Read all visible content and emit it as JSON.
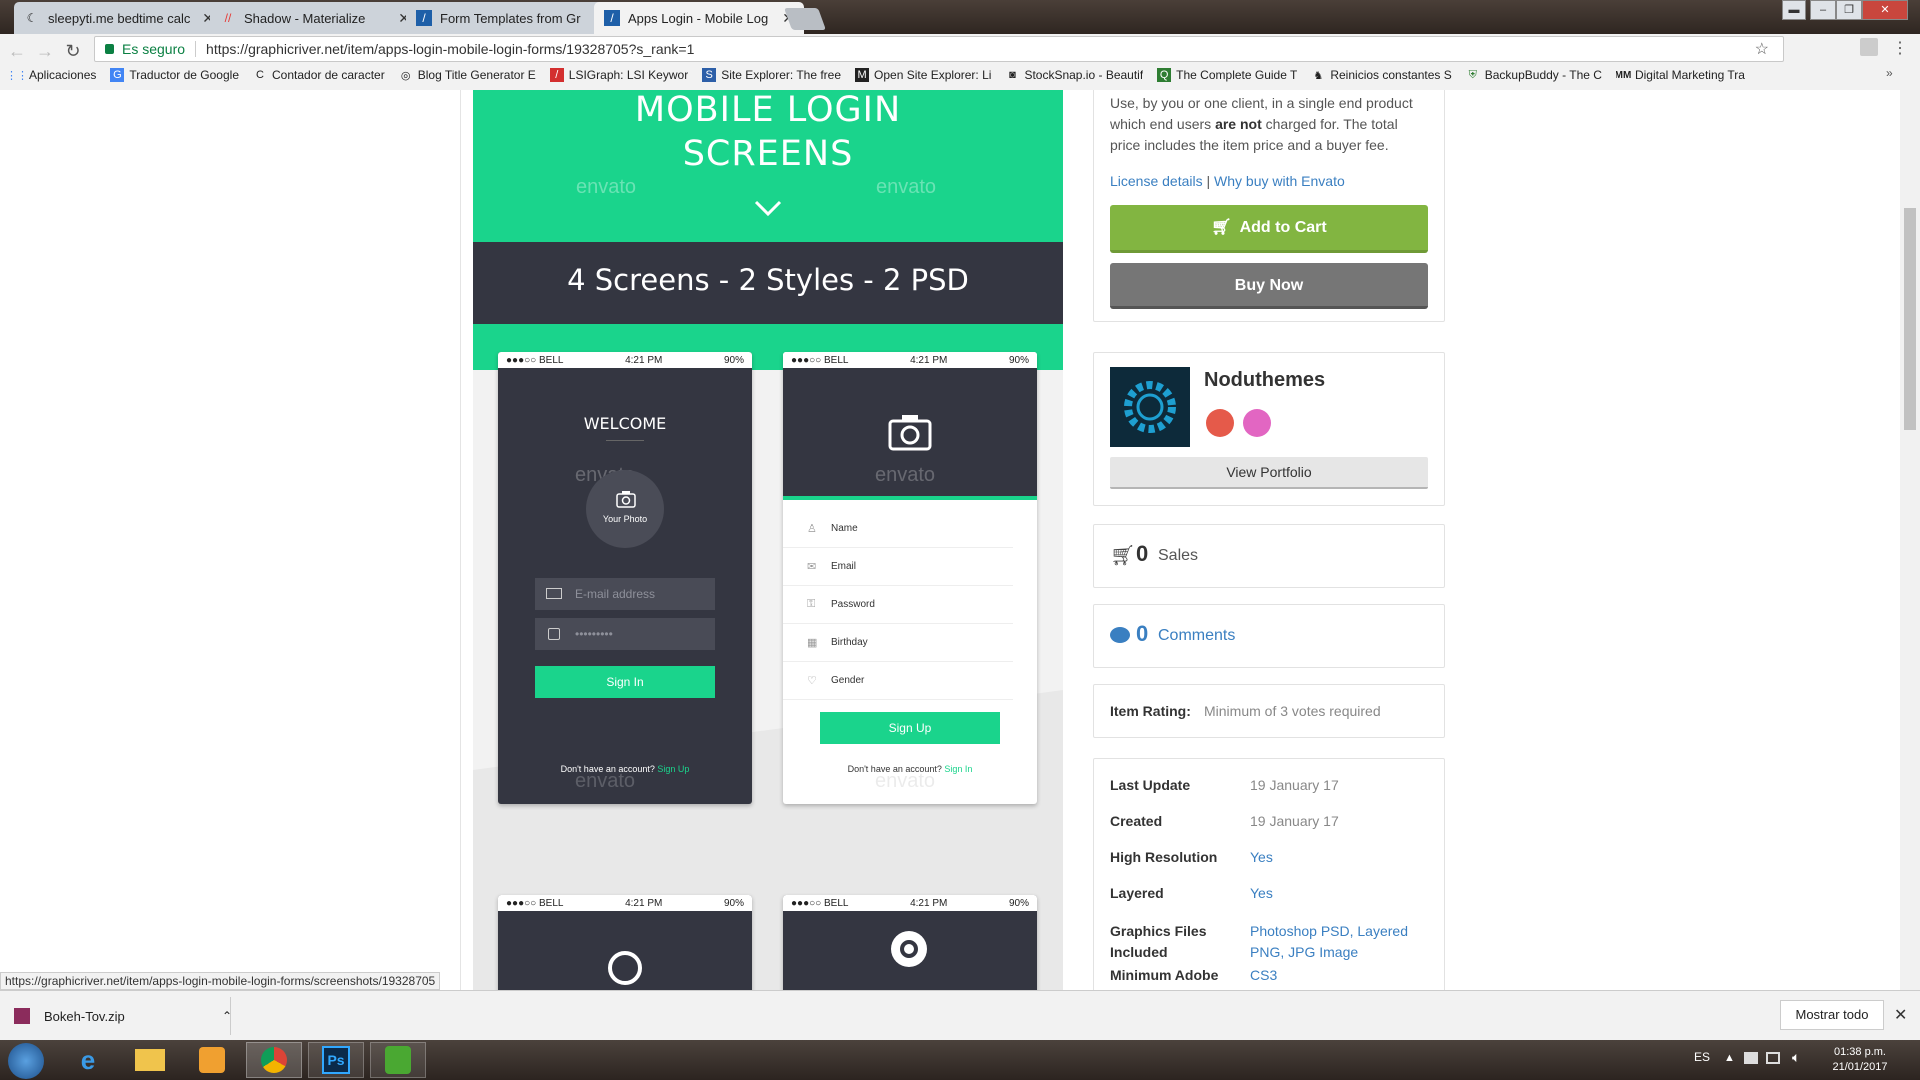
{
  "tabs": [
    {
      "label": "sleepyti.me bedtime calc",
      "icon": "moon-icon"
    },
    {
      "label": "Shadow - Materialize",
      "icon": "materialize-icon"
    },
    {
      "label": "Form Templates from Gr",
      "icon": "envato-icon"
    },
    {
      "label": "Apps Login - Mobile Log",
      "icon": "envato-icon"
    }
  ],
  "address_bar": {
    "secure_label": "Es seguro",
    "url": "https://graphicriver.net/item/apps-login-mobile-login-forms/19328705?s_rank=1"
  },
  "bookmarks": [
    {
      "label": "Aplicaciones"
    },
    {
      "label": "Traductor de Google"
    },
    {
      "label": "Contador de caracter"
    },
    {
      "label": "Blog Title Generator E"
    },
    {
      "label": "LSIGraph: LSI Keywor"
    },
    {
      "label": "Site Explorer: The free"
    },
    {
      "label": "Open Site Explorer: Li"
    },
    {
      "label": "StockSnap.io - Beautif"
    },
    {
      "label": "The Complete Guide T"
    },
    {
      "label": "Reinicios constantes S"
    },
    {
      "label": "BackupBuddy - The C"
    },
    {
      "label": "Digital Marketing Tra"
    }
  ],
  "preview": {
    "hero_line1": "MOBILE LOGIN",
    "hero_line2": "SCREENS",
    "watermark": "envato",
    "subtitle": "4 Screens - 2 Styles - 2 PSD",
    "status_carrier": "●●●○○ BELL",
    "status_time": "4:21 PM",
    "status_battery": "90%",
    "phone1": {
      "title": "WELCOME",
      "photo_label": "Your Photo",
      "email_placeholder": "E-mail address",
      "password_value": "•••••••••",
      "button": "Sign In",
      "footer": "Don't have an account?",
      "footer_link": "Sign Up"
    },
    "phone2": {
      "fields": [
        "Name",
        "Email",
        "Password",
        "Birthday",
        "Gender"
      ],
      "button": "Sign Up",
      "footer": "Don't have an account?",
      "footer_link": "Sign In"
    }
  },
  "sidebar": {
    "license_text_1": "Use, by you or one client, in a single end product",
    "license_text_2a": "which end users ",
    "license_text_2b": "are not",
    "license_text_2c": " charged for. The total",
    "license_text_3": "price includes the item price and a buyer fee.",
    "license_details": "License details",
    "link_sep": "|",
    "why_envato": "Why buy with Envato",
    "add_to_cart": "Add to Cart",
    "buy_now": "Buy Now",
    "author": "Noduthemes",
    "view_portfolio": "View Portfolio",
    "sales_count": "0",
    "sales_label": "Sales",
    "comments_count": "0",
    "comments_label": "Comments",
    "rating_label": "Item Rating:",
    "rating_value": "Minimum of 3 votes required",
    "meta": [
      {
        "label": "Last Update",
        "value": "19 January 17"
      },
      {
        "label": "Created",
        "value": "19 January 17"
      },
      {
        "label": "High Resolution",
        "value": "Yes"
      },
      {
        "label": "Layered",
        "value": "Yes"
      }
    ],
    "graphics_label_1": "Graphics Files",
    "graphics_label_2": "Included",
    "graphics_value_1": "Photoshop PSD, Layered",
    "graphics_value_2": "PNG, JPG Image",
    "adobe_label": "Minimum Adobe",
    "adobe_value": "CS3"
  },
  "status_url": "https://graphicriver.net/item/apps-login-mobile-login-forms/screenshots/19328705",
  "download": {
    "file": "Bokeh-Tov.zip",
    "show_all": "Mostrar todo"
  },
  "taskbar": {
    "lang": "ES",
    "time": "01:38 p.m.",
    "date": "21/01/2017"
  },
  "colors": {
    "accent_green": "#1ad48c",
    "dark_panel": "#343641",
    "cart_green": "#82b541",
    "link_blue": "#3a7fc1"
  }
}
